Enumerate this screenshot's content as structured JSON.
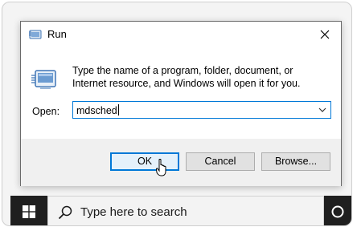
{
  "dialog": {
    "title": "Run",
    "description": "Type the name of a program, folder, document, or Internet resource, and Windows will open it for you.",
    "open_label": "Open:",
    "open_value": "mdsched",
    "buttons": {
      "ok": "OK",
      "cancel": "Cancel",
      "browse": "Browse..."
    }
  },
  "taskbar": {
    "search_placeholder": "Type here to search"
  },
  "colors": {
    "accent": "#0078d7",
    "taskbar": "#1f1f1f"
  },
  "icons": [
    "run-icon",
    "close-icon",
    "run-program-icon",
    "dropdown-arrow-icon",
    "mouse-cursor-icon",
    "windows-start-icon",
    "search-icon",
    "cortana-icon"
  ]
}
